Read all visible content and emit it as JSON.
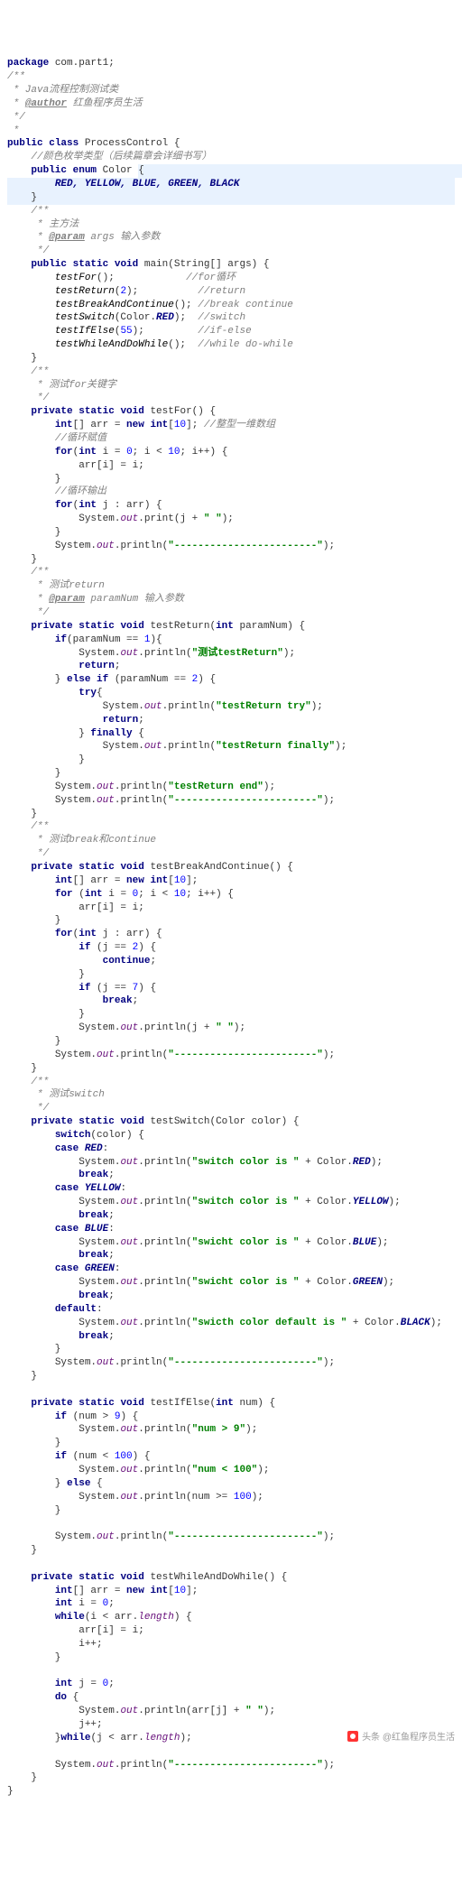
{
  "pkg_kw": "package",
  "pkg_name": " com.part1;",
  "doc_open": "/**",
  "doc_star": " *",
  "doc_close": " */",
  "c_class1": " Java流程控制测试类",
  "c_author_tag": "@author",
  "c_author_val": " 红鱼程序员生活",
  "kw_public": "public",
  "kw_class": "class",
  "cls_name": " ProcessControl {",
  "c_enum": "//颜色枚举类型（后续篇章会详细书写）",
  "kw_enum": "enum",
  "enum_name": " Color ",
  "brace_open_hl": "{",
  "enum_vals": "RED, YELLOW, BLUE, GREEN, BLACK",
  "brace_close_hl": "}",
  "c_main1": " 主方法",
  "c_main2_tag": "@param",
  "c_main2_val": " args 输入参数",
  "kw_static": "static",
  "kw_void": "void",
  "kw_int": "int",
  "kw_new": "new",
  "kw_for": "for",
  "kw_if": "if",
  "kw_else": "else",
  "kw_return": "return",
  "kw_try": "try",
  "kw_finally": "finally",
  "kw_switch": "switch",
  "kw_case": "case",
  "kw_default": "default",
  "kw_break": "break",
  "kw_continue": "continue",
  "kw_while": "while",
  "kw_do": "do",
  "kw_private": "private",
  "m_main_sig": " main(String[] args) {",
  "main_l1a": "testFor",
  "main_l1b": "();            ",
  "main_l1c": "//for循环",
  "main_l2a": "testReturn",
  "main_l2b": "(",
  "main_l2n": "2",
  "main_l2c": ");          ",
  "main_l2d": "//return",
  "main_l3a": "testBreakAndContinue",
  "main_l3b": "(); ",
  "main_l3c": "//break continue",
  "main_l4a": "testSwitch",
  "main_l4b": "(Color.",
  "main_l4c": "RED",
  "main_l4d": ");  ",
  "main_l4e": "//switch",
  "main_l5a": "testIfElse",
  "main_l5b": "(",
  "main_l5n": "55",
  "main_l5c": ");         ",
  "main_l5d": "//if-else",
  "main_l6a": "testWhileAndDoWhile",
  "main_l6b": "();  ",
  "main_l6c": "//while do-while",
  "c_testfor": " 测试for关键字",
  "m_testfor_sig": " testFor() {",
  "tf_l1a": "[] arr = ",
  "tf_l1b": "[",
  "tf_l1n": "10",
  "tf_l1c": "]; ",
  "tf_l1d": "//整型一维数组",
  "tf_c1": "//循环赋值",
  "tf_for1a": "(",
  "tf_for1b": " i = ",
  "tf_for1n0": "0",
  "tf_for1c": "; i < ",
  "tf_for1n1": "10",
  "tf_for1d": "; i++) {",
  "tf_body1": "arr[i] = i;",
  "tf_c2": "//循环输出",
  "tf_for2": "(",
  "tf_for2b": " j : arr) {",
  "tf_print1a": "System.",
  "tf_out": "out",
  "tf_print1b": ".print(j + ",
  "tf_print1s": "\" \"",
  "tf_print1c": ");",
  "dash_str": "\"------------------------\"",
  "println_open": ".println(",
  "println_close": ");",
  "c_testret": " 测试return",
  "c_testret2_tag": "@param",
  "c_testret2_val": " paramNum 输入参数",
  "m_testret_sig": " testReturn(",
  "m_testret_sig2": " paramNum) {",
  "tr_if1a": "(paramNum == ",
  "tr_if1n": "1",
  "tr_if1b": "){",
  "tr_s1": "\"测试testReturn\"",
  "tr_ret": ";",
  "tr_elif_a": " (paramNum == ",
  "tr_elif_n": "2",
  "tr_elif_b": ") {",
  "tr_try_open": "{",
  "tr_s2": "\"testReturn try\"",
  "tr_fin_open": " {",
  "tr_s3": "\"testReturn finally\"",
  "tr_s4": "\"testReturn end\"",
  "c_testbc": " 测试break和continue",
  "m_testbc_sig": " testBreakAndContinue() {",
  "bc_if1a": " (j == ",
  "bc_if1n": "2",
  "bc_if1b": ") {",
  "bc_if2n": "7",
  "bc_pr_a": ".println(j + ",
  "bc_pr_s": "\" \"",
  "c_testsw": " 测试switch",
  "m_testsw_sig": " testSwitch(Color color) {",
  "sw_open": "(color) {",
  "sw_c_red": "RED",
  "sw_c_yel": "YELLOW",
  "sw_c_blu": "BLUE",
  "sw_c_grn": "GREEN",
  "sw_s_pre": "\"switch color is \"",
  "sw_s_pre2": "\"swicht color is \"",
  "sw_s_def": "\"swicth color default is \"",
  "sw_plus": " + Color.",
  "sw_black": "BLACK",
  "m_testif_sig": " testIfElse(",
  "m_testif_sig2": " num) {",
  "ie_if1a": " (num > ",
  "ie_if1n": "9",
  "ie_if1b": ") {",
  "ie_s1": "\"num > 9\"",
  "ie_if2n": "100",
  "ie_s2": "\"num < 100\"",
  "ie_if2a": " (num < ",
  "ie_else_open": " {",
  "ie_pr3a": ".println(num >= ",
  "ie_pr3n": "100",
  "m_testwh_sig": " testWhileAndDoWhile() {",
  "wh_i0": " i = ",
  "wh_cond": "(i < arr.",
  "wh_len": "length",
  "wh_condc": ") {",
  "wh_body1": "arr[i] = i;",
  "wh_ipp": "i++;",
  "wh_j0": " j = ",
  "wh_doopen": " {",
  "wh_pr_a": ".println(arr[j] + ",
  "wh_pr_s": "\" \"",
  "wh_jpp": "j++;",
  "wh_while2a": "(j < arr.",
  "wh_while2c": ");",
  "watermark": "头条 @红鱼程序员生活"
}
